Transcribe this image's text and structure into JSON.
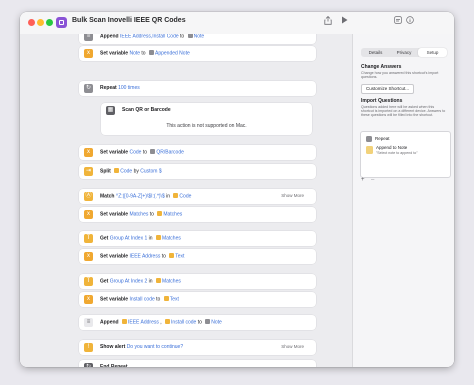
{
  "window": {
    "title": "Bulk Scan Inovelli IEEE QR Codes"
  },
  "actions": [
    {
      "keyword": "Append",
      "parts": [
        {
          "t": "var",
          "v": "IEEE Address,Install Code"
        },
        {
          "t": "plain",
          "v": "to"
        },
        {
          "t": "var",
          "v": "Note",
          "chip": "gray"
        }
      ],
      "icon_color": "#8d8d92",
      "icon": "document-icon",
      "type": "append-action"
    },
    {
      "keyword": "Set variable",
      "parts": [
        {
          "t": "var",
          "v": "Note"
        },
        {
          "t": "plain",
          "v": "to"
        },
        {
          "t": "var",
          "v": "Appended Note",
          "chip": "gray"
        }
      ],
      "icon_color": "#f0a830",
      "icon": "variable-icon",
      "type": "set-variable-action"
    },
    {
      "keyword": "Repeat",
      "parts": [
        {
          "t": "var",
          "v": "100 times"
        }
      ],
      "icon_color": "#8d8d92",
      "icon": "repeat-icon",
      "type": "repeat-action"
    },
    {
      "keyword": "Scan QR or Barcode",
      "note": "This action is not supported on Mac.",
      "icon_color": "#5f5f64",
      "icon": "qr-icon",
      "type": "scan-action"
    },
    {
      "keyword": "Set variable",
      "parts": [
        {
          "t": "var",
          "v": "Code"
        },
        {
          "t": "plain",
          "v": "to"
        },
        {
          "t": "var",
          "v": "QR/Barcode",
          "chip": "gray"
        }
      ],
      "icon_color": "#f0a830",
      "icon": "variable-icon",
      "type": "set-variable-action"
    },
    {
      "keyword": "Split",
      "parts": [
        {
          "t": "var",
          "v": "Code",
          "chip": "yellow"
        },
        {
          "t": "plain",
          "v": "by"
        },
        {
          "t": "var",
          "v": "Custom"
        },
        {
          "t": "var",
          "v": "$"
        }
      ],
      "icon_color": "#f0b43a",
      "icon": "split-icon",
      "type": "split-action"
    },
    {
      "keyword": "Match",
      "parts": [
        {
          "t": "var",
          "v": "^Z:([0-9A-Z]+)\\$I:(.*)\\$"
        },
        {
          "t": "plain",
          "v": "in"
        },
        {
          "t": "var",
          "v": "Code",
          "chip": "yellow"
        }
      ],
      "show_more": "Show More",
      "icon_color": "#f0b43a",
      "icon": "match-icon",
      "type": "match-action"
    },
    {
      "keyword": "Set variable",
      "parts": [
        {
          "t": "var",
          "v": "Matches"
        },
        {
          "t": "plain",
          "v": "to"
        },
        {
          "t": "var",
          "v": "Matches",
          "chip": "yellow"
        }
      ],
      "icon_color": "#f0a830",
      "icon": "variable-icon",
      "type": "set-variable-action"
    },
    {
      "keyword": "Get",
      "parts": [
        {
          "t": "var",
          "v": "Group At Index"
        },
        {
          "t": "var",
          "v": "1"
        },
        {
          "t": "plain",
          "v": "in"
        },
        {
          "t": "var",
          "v": "Matches",
          "chip": "yellow"
        }
      ],
      "icon_color": "#f0b43a",
      "icon": "text-icon",
      "type": "get-group-action"
    },
    {
      "keyword": "Set variable",
      "parts": [
        {
          "t": "var",
          "v": "IEEE Address"
        },
        {
          "t": "plain",
          "v": "to"
        },
        {
          "t": "var",
          "v": "Text",
          "chip": "yellow"
        }
      ],
      "icon_color": "#f0a830",
      "icon": "variable-icon",
      "type": "set-variable-action"
    },
    {
      "keyword": "Get",
      "parts": [
        {
          "t": "var",
          "v": "Group At Index"
        },
        {
          "t": "var",
          "v": "2"
        },
        {
          "t": "plain",
          "v": "in"
        },
        {
          "t": "var",
          "v": "Matches",
          "chip": "yellow"
        }
      ],
      "icon_color": "#f0b43a",
      "icon": "text-icon",
      "type": "get-group-action"
    },
    {
      "keyword": "Set variable",
      "parts": [
        {
          "t": "var",
          "v": "Install code"
        },
        {
          "t": "plain",
          "v": "to"
        },
        {
          "t": "var",
          "v": "Text",
          "chip": "yellow"
        }
      ],
      "icon_color": "#f0a830",
      "icon": "variable-icon",
      "type": "set-variable-action"
    },
    {
      "keyword": "Append",
      "parts": [
        {
          "t": "var",
          "v": "IEEE Address",
          "chip": "yellow"
        },
        {
          "t": "plain",
          "v": ","
        },
        {
          "t": "var",
          "v": "Install code",
          "chip": "yellow"
        },
        {
          "t": "plain",
          "v": "to"
        },
        {
          "t": "var",
          "v": "Note",
          "chip": "gray"
        }
      ],
      "icon_color": "#e9e9ec",
      "icon": "document-icon",
      "type": "append-action"
    },
    {
      "keyword": "Show alert",
      "parts": [
        {
          "t": "var",
          "v": "Do you want to continue?"
        }
      ],
      "show_more": "Show More",
      "icon_color": "#f0b43a",
      "icon": "alert-icon",
      "type": "alert-action"
    },
    {
      "keyword": "End Repeat",
      "parts": [],
      "icon_color": "#5f5f64",
      "icon": "repeat-icon",
      "type": "end-repeat-action"
    }
  ],
  "sidebar": {
    "tabs": [
      "Details",
      "Privacy",
      "Setup"
    ],
    "selected_tab": "Setup",
    "change_answers": {
      "heading": "Change Answers",
      "desc": "Change how you answered this shortcut's import questions.",
      "button": "Customize Shortcut..."
    },
    "import_questions": {
      "heading": "Import Questions",
      "desc": "Questions added here will be asked when this shortcut is imported on a different device. Answers to these questions will be filled into the shortcut.",
      "group": "Repeat",
      "item_title": "Append to Note",
      "item_sub": "\"Select note to append to\"",
      "add_label": "+",
      "remove_label": "–"
    }
  },
  "colors": {
    "accent": "#3a6fd8",
    "close": "#fe5f57",
    "minimize": "#febc2e",
    "zoom": "#28c840"
  }
}
